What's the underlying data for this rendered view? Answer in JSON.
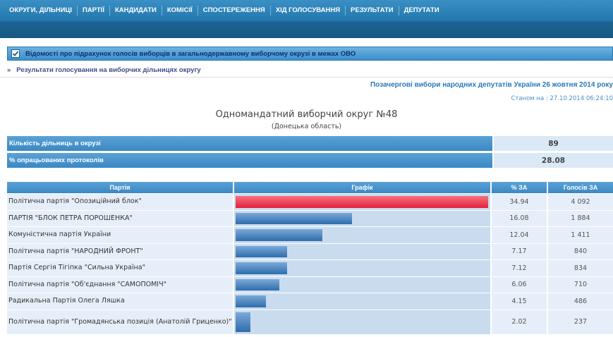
{
  "nav": {
    "items": [
      "ОКРУГИ, ДІЛЬНИЦІ",
      "ПАРТІЇ",
      "КАНДИДАТИ",
      "КОМІСІЇ",
      "СПОСТЕРЕЖЕННЯ",
      "ХІД ГОЛОСУВАННЯ",
      "РЕЗУЛЬТАТИ",
      "ДЕПУТАТИ"
    ]
  },
  "infobar": {
    "title": "Відомості про підрахунок голосів виборців в загальнодержавному виборчому окрузі в межах ОВО"
  },
  "breadcrumb": {
    "symbol": "»",
    "text": "Результати голосування на виборчих дільницях округу"
  },
  "election": {
    "title": "Позачергові вибори народних депутатів України 26 жовтня 2014 року",
    "as_of": "Станом на : 27.10.2014 06:24:10",
    "district": "Одномандатний виборчий округ №48",
    "region": "(Донецька область)"
  },
  "stats": [
    {
      "label": "Кількість дільниць в окрузі",
      "value": "89"
    },
    {
      "label": "% опрацьованих протоколів",
      "value": "28.08"
    }
  ],
  "results": {
    "headers": [
      "Партія",
      "Графік",
      "% ЗА",
      "Голосів ЗА"
    ],
    "rows": [
      {
        "party": "Політична партія \"Опозиційний блок\"",
        "percent": "34.94",
        "votes": "4 092",
        "share": 34.94
      },
      {
        "party": "ПАРТІЯ \"БЛОК ПЕТРА ПОРОШЕНКА\"",
        "percent": "16.08",
        "votes": "1 884",
        "share": 16.08
      },
      {
        "party": "Комуністична партія України",
        "percent": "12.04",
        "votes": "1 411",
        "share": 12.04
      },
      {
        "party": "Політична партія \"НАРОДНИЙ ФРОНТ\"",
        "percent": "7.17",
        "votes": "840",
        "share": 7.17
      },
      {
        "party": "Партія Сергія Тігіпка \"Сильна Україна\"",
        "percent": "7.12",
        "votes": "834",
        "share": 7.12
      },
      {
        "party": "Політична партія \"Об'єднання \"САМОПОМІЧ\"",
        "percent": "6.06",
        "votes": "710",
        "share": 6.06
      },
      {
        "party": "Радикальна Партія Олега Ляшка",
        "percent": "4.15",
        "votes": "486",
        "share": 4.15
      },
      {
        "party": "Політична партія \"Громадянська позиція (Анатолій Гриценко)\"",
        "percent": "2.02",
        "votes": "237",
        "share": 2.02
      }
    ]
  },
  "colors": {
    "nav_bg": "#2a80b8",
    "lead_bar": "#e3223b",
    "bar": "#2f6dac"
  }
}
